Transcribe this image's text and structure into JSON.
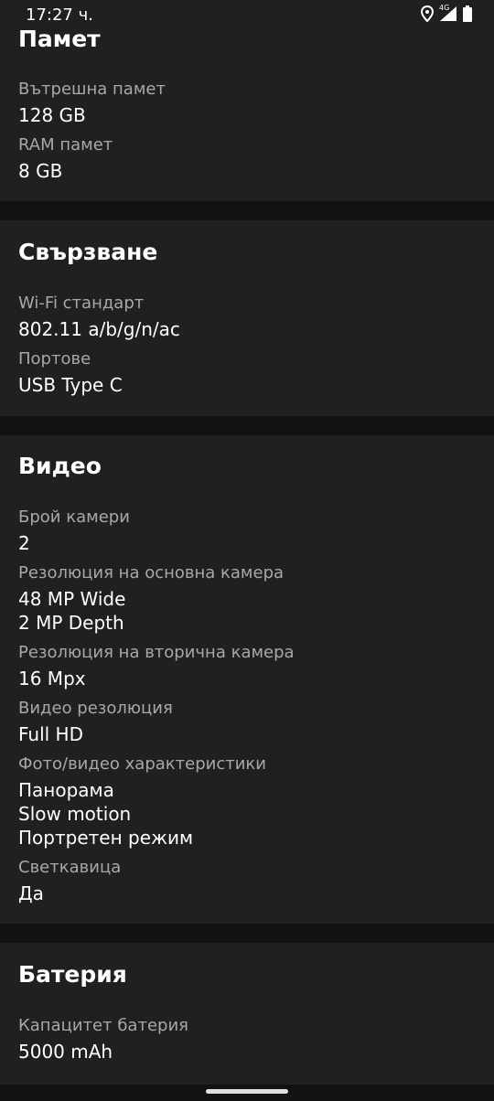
{
  "status_bar": {
    "time": "17:27 ч.",
    "network_label": "4G"
  },
  "sections": {
    "memory": {
      "title": "Памет",
      "internal_label": "Вътрешна памет",
      "internal_value": "128 GB",
      "ram_label": "RAM памет",
      "ram_value": "8 GB"
    },
    "connectivity": {
      "title": "Свързване",
      "wifi_label": "Wi-Fi стандарт",
      "wifi_value": "802.11 a/b/g/n/ac",
      "ports_label": "Портове",
      "ports_value": "USB Type C"
    },
    "video": {
      "title": "Видео",
      "cameras_label": "Брой камери",
      "cameras_value": "2",
      "main_res_label": "Резолюция на основна камера",
      "main_res_values": [
        "48 MP Wide",
        "2 MP Depth"
      ],
      "secondary_res_label": "Резолюция на вторична камера",
      "secondary_res_value": "16 Mpx",
      "video_res_label": "Видео резолюция",
      "video_res_value": "Full HD",
      "features_label": "Фото/видео характеристики",
      "features_values": [
        "Панорама",
        "Slow motion",
        "Портретен режим"
      ],
      "flash_label": "Светкавица",
      "flash_value": "Да"
    },
    "battery": {
      "title": "Батерия",
      "capacity_label": "Капацитет батерия",
      "capacity_value": "5000 mAh"
    }
  },
  "colors": {
    "background": "#121212",
    "card": "#202020",
    "label": "#a8a8a8",
    "text": "#ffffff"
  }
}
